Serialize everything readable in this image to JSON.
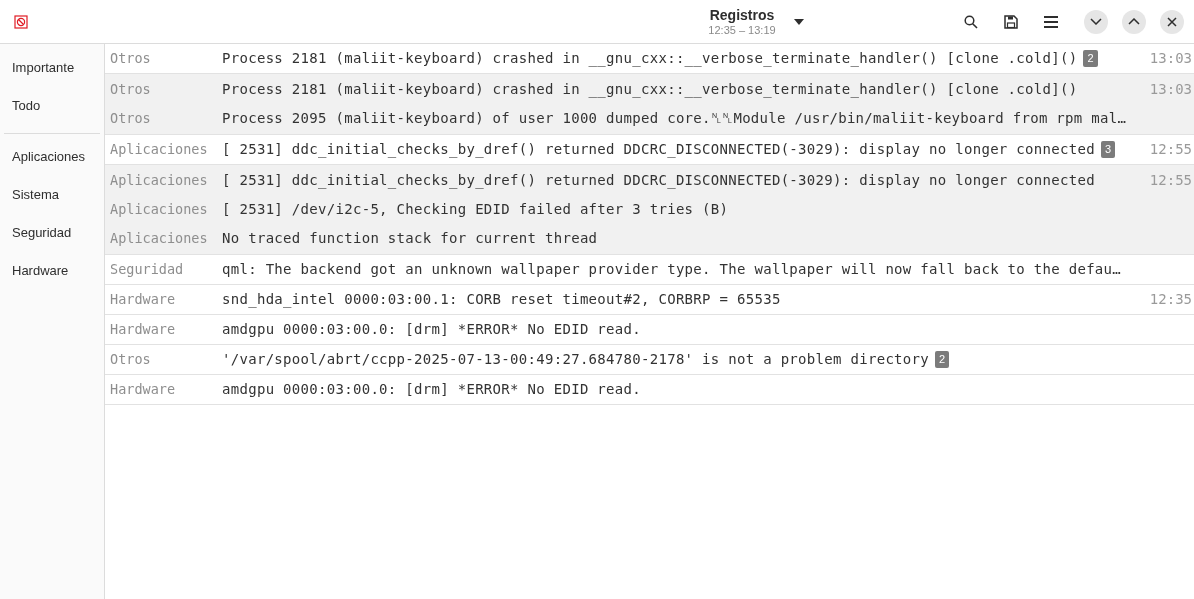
{
  "header": {
    "title": "Registros",
    "subtitle": "12:35 – 13:19"
  },
  "sidebar": {
    "sections": [
      [
        {
          "label": "Importante",
          "selected": false
        },
        {
          "label": "Todo",
          "selected": false
        }
      ],
      [
        {
          "label": "Aplicaciones",
          "selected": false
        },
        {
          "label": "Sistema",
          "selected": false
        },
        {
          "label": "Seguridad",
          "selected": false
        },
        {
          "label": "Hardware",
          "selected": false
        }
      ]
    ]
  },
  "groups": [
    {
      "expanded": false,
      "rows": [
        {
          "category": "Otros",
          "message": "Process 2181 (maliit-keyboard) crashed in __gnu_cxx::__verbose_terminate_handler() [clone .cold]()",
          "badge": "2",
          "time": "13:03"
        }
      ]
    },
    {
      "expanded": true,
      "rows": [
        {
          "category": "Otros",
          "message": "Process 2181 (maliit-keyboard) crashed in __gnu_cxx::__verbose_terminate_handler() [clone .cold]()",
          "time": "13:03"
        },
        {
          "category": "Otros",
          "message": "Process 2095 (maliit-keyboard) of user 1000 dumped core.␤␤Module /usr/bin/maliit-keyboard from rpm mal…"
        }
      ]
    },
    {
      "expanded": false,
      "rows": [
        {
          "category": "Aplicaciones",
          "message": "[  2531] ddc_initial_checks_by_dref() returned DDCRC_DISCONNECTED(-3029): display no longer connected",
          "badge": "3",
          "time": "12:55"
        }
      ]
    },
    {
      "expanded": true,
      "rows": [
        {
          "category": "Aplicaciones",
          "message": "[  2531] ddc_initial_checks_by_dref() returned DDCRC_DISCONNECTED(-3029): display no longer connected",
          "time": "12:55"
        },
        {
          "category": "Aplicaciones",
          "message": "[  2531] /dev/i2c-5, Checking EDID failed after 3 tries (B)"
        },
        {
          "category": "Aplicaciones",
          "message": "No traced function stack for current thread"
        }
      ]
    },
    {
      "expanded": false,
      "rows": [
        {
          "category": "Seguridad",
          "message": "qml: The backend got an unknown wallpaper provider type. The wallpaper will now fall back to the defau…"
        }
      ]
    },
    {
      "expanded": false,
      "rows": [
        {
          "category": "Hardware",
          "message": "snd_hda_intel 0000:03:00.1: CORB reset timeout#2, CORBRP = 65535",
          "time": "12:35"
        }
      ]
    },
    {
      "expanded": false,
      "rows": [
        {
          "category": "Hardware",
          "message": "amdgpu 0000:03:00.0: [drm] *ERROR* No EDID read."
        }
      ]
    },
    {
      "expanded": false,
      "rows": [
        {
          "category": "Otros",
          "message": "'/var/spool/abrt/ccpp-2025-07-13-00:49:27.684780-2178' is not a problem directory",
          "badge": "2"
        }
      ]
    },
    {
      "expanded": false,
      "rows": [
        {
          "category": "Hardware",
          "message": "amdgpu 0000:03:00.0: [drm] *ERROR* No EDID read."
        }
      ]
    }
  ]
}
